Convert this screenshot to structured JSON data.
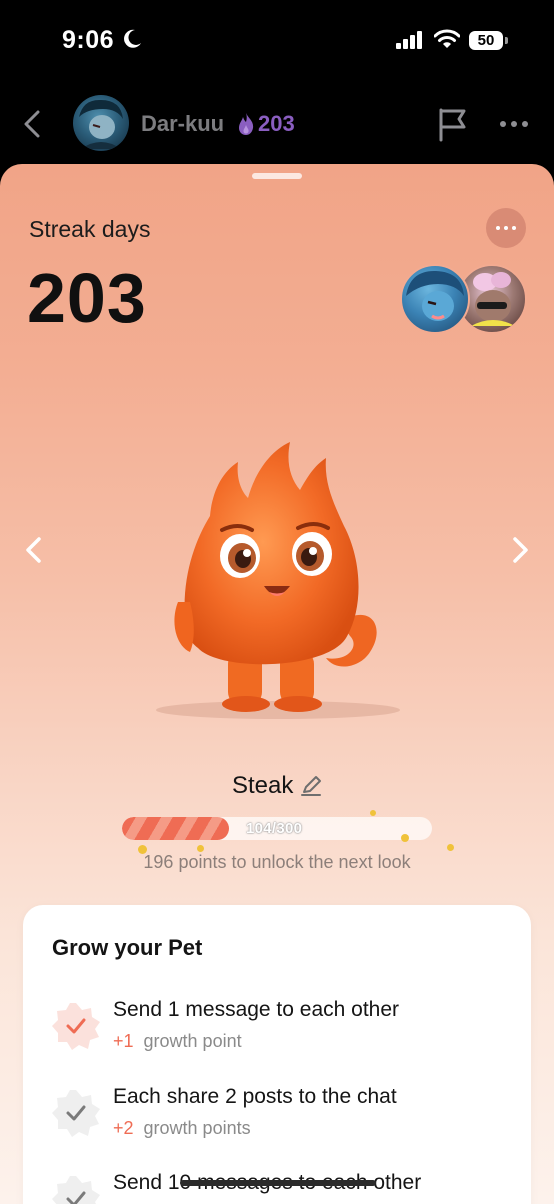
{
  "status_bar": {
    "time": "9:06",
    "battery": "50",
    "icons": [
      "moon-icon",
      "signal-icon",
      "wifi-icon",
      "battery-icon"
    ]
  },
  "header": {
    "back_icon": "chevron-left-icon",
    "name": "Dar-kuu",
    "streak": "203",
    "streak_icon": "purple-flame-icon",
    "flag_icon": "flag-icon",
    "more_icon": "ellipsis-icon"
  },
  "streak": {
    "label": "Streak days",
    "count": "203"
  },
  "pet": {
    "name": "Steak",
    "progress_text": "104/300",
    "progress_fraction": 0.3467,
    "unlock_text": "196 points to unlock the next look",
    "nav_prev_icon": "chevron-left-icon",
    "nav_next_icon": "chevron-right-icon"
  },
  "grow": {
    "title": "Grow your Pet",
    "tasks": [
      {
        "title": "Send 1 message to each other",
        "plus": "+1",
        "reward": "growth point",
        "done": true
      },
      {
        "title": "Each share 2 posts to the chat",
        "plus": "+2",
        "reward": "growth points",
        "done": false
      },
      {
        "title": "Send 10 messages to each other",
        "plus": "",
        "reward": "",
        "done": false
      }
    ]
  },
  "colors": {
    "accent": "#ef6c54",
    "streak_purple": "#8a5ec0",
    "sheet_top": "#f1a487",
    "sheet_bottom": "#fdf2ec"
  }
}
